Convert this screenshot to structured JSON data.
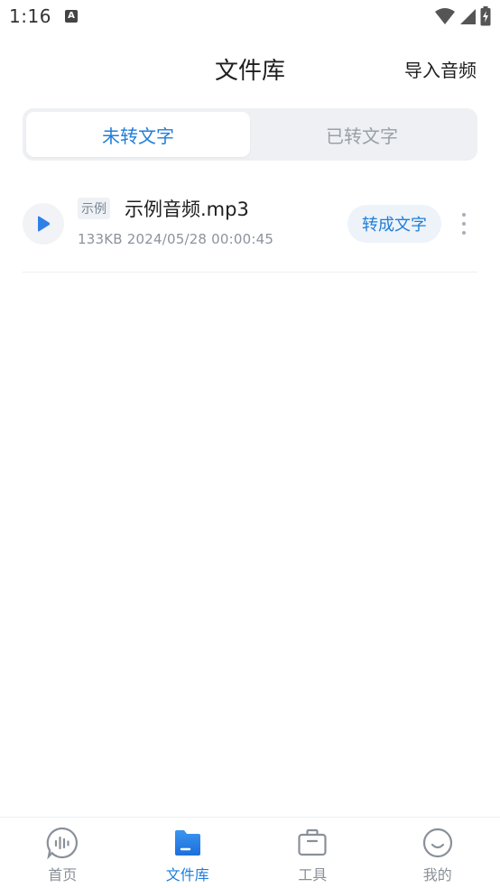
{
  "status_bar": {
    "time": "1:16",
    "a_badge": "A"
  },
  "header": {
    "title": "文件库",
    "import_label": "导入音频"
  },
  "tabs": [
    {
      "label": "未转文字",
      "active": true
    },
    {
      "label": "已转文字",
      "active": false
    }
  ],
  "files": [
    {
      "tag": "示例",
      "name": "示例音频.mp3",
      "meta": "133KB 2024/05/28 00:00:45",
      "convert_label": "转成文字"
    }
  ],
  "bottom_nav": [
    {
      "label": "首页",
      "icon": "voice-wave-icon",
      "active": false
    },
    {
      "label": "文件库",
      "icon": "folder-icon",
      "active": true
    },
    {
      "label": "工具",
      "icon": "toolbox-icon",
      "active": false
    },
    {
      "label": "我的",
      "icon": "smiley-icon",
      "active": false
    }
  ],
  "colors": {
    "accent": "#1f7ed9",
    "muted": "#8a9099",
    "tab_bg": "#eef0f3"
  }
}
